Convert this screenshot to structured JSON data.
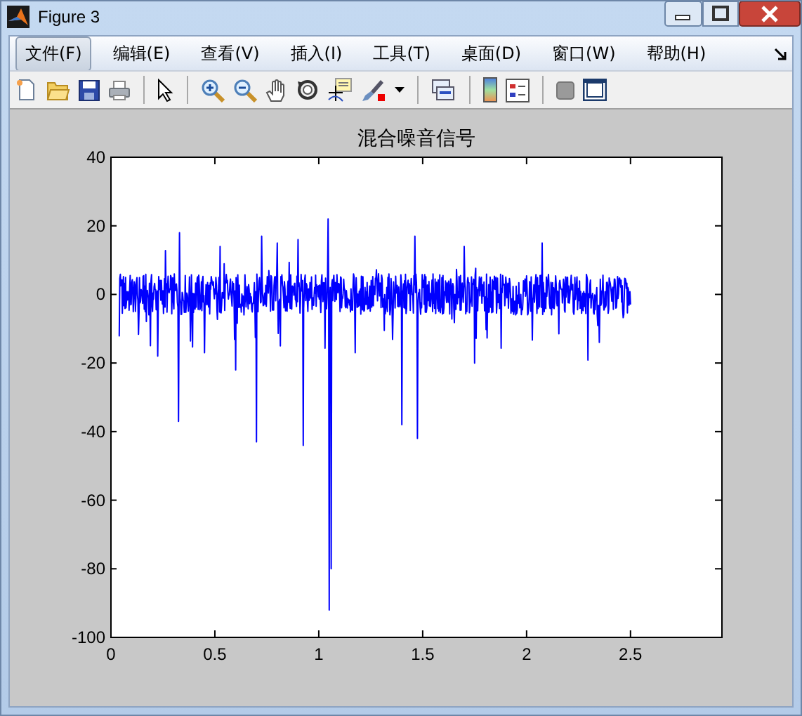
{
  "window": {
    "title": "Figure 3"
  },
  "menu": [
    {
      "label": "文件(F)",
      "selected": true
    },
    {
      "label": "编辑(E)",
      "selected": false
    },
    {
      "label": "查看(V)",
      "selected": false
    },
    {
      "label": "插入(I)",
      "selected": false
    },
    {
      "label": "工具(T)",
      "selected": false
    },
    {
      "label": "桌面(D)",
      "selected": false
    },
    {
      "label": "窗口(W)",
      "selected": false
    },
    {
      "label": "帮助(H)",
      "selected": false
    }
  ],
  "plot": {
    "chart_data": {
      "type": "line",
      "title": "混合噪音信号",
      "xlim": [
        0,
        2.94
      ],
      "ylim": [
        -100,
        40
      ],
      "xticks": [
        0,
        0.5,
        1,
        1.5,
        2,
        2.5
      ],
      "yticks": [
        -100,
        -80,
        -60,
        -40,
        -20,
        0,
        20,
        40
      ]
    }
  }
}
